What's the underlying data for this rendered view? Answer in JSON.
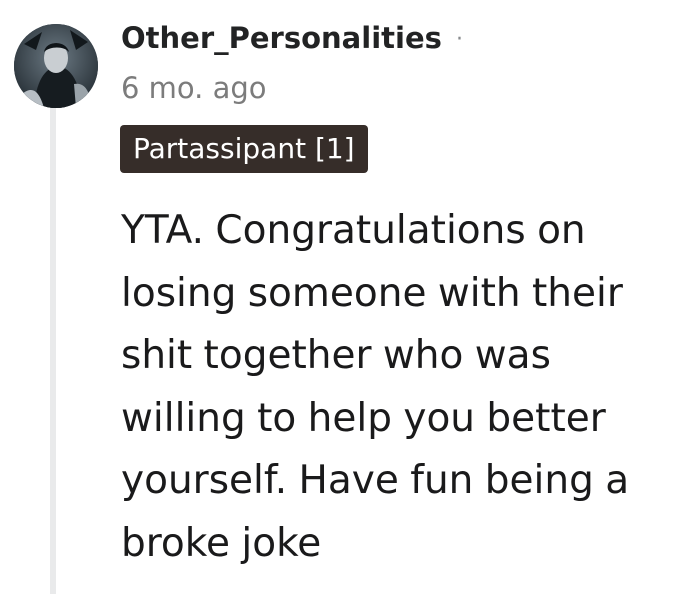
{
  "comment": {
    "author": "Other_Personalities",
    "separator": "·",
    "timestamp": "6 mo. ago",
    "flair": "Partassipant [1]",
    "body": "YTA. Congratulations on losing someone with their shit together who was willing to help you better yourself. Have fun being a broke joke",
    "avatar_icon": "character-portrait-avatar"
  },
  "colors": {
    "flair_background": "#362d29",
    "thread_line": "#e9eaeb",
    "timestamp": "#7c7c7c",
    "text": "#1a1a1b"
  }
}
